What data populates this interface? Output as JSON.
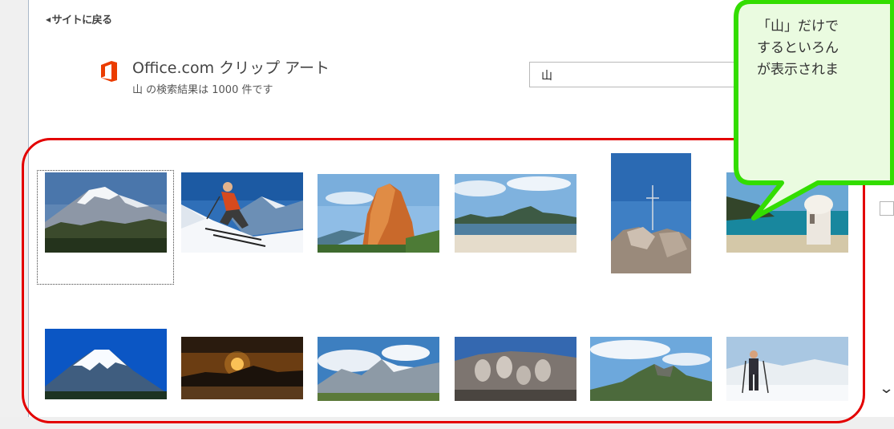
{
  "nav": {
    "back_label": "サイトに戻る"
  },
  "header": {
    "title": "Office.com クリップ アート",
    "subtitle": "山 の検索結果は 1000 件です",
    "brand_color": "#eb3c00"
  },
  "search": {
    "value": "山"
  },
  "callout": {
    "line1": "「山」だけで",
    "line2": "するといろん",
    "line3": "が表示されま",
    "border_color": "#33dd00",
    "fill_color": "#eafbe0"
  },
  "results": {
    "row1": [
      "snow-peak",
      "skier",
      "sugarloaf-rock",
      "bay-beach",
      "summit-cross",
      "seaside-turret"
    ],
    "row2": [
      "mount-fuji",
      "sunset-mountains",
      "alpine-valley",
      "mount-rushmore",
      "green-peaks",
      "snow-hiker"
    ]
  },
  "highlight_color": "#e30000"
}
